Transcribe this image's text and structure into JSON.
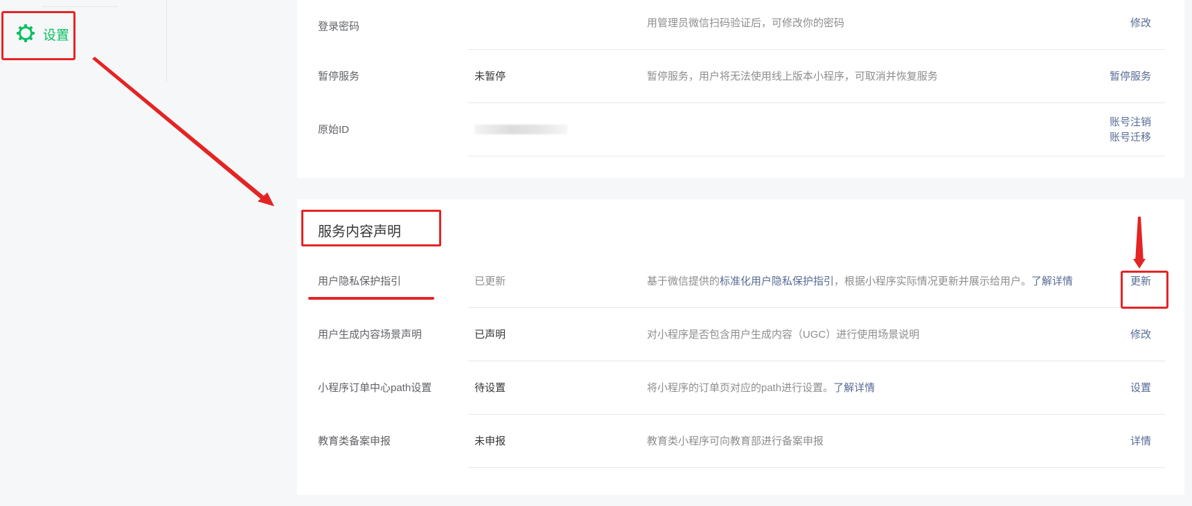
{
  "sidebar": {
    "settings_label": "设置",
    "settings_icon": "gear-icon",
    "accent": "#07c160"
  },
  "account_rows": [
    {
      "name": "登录密码",
      "status": "",
      "desc": "用管理员微信扫码验证后，可修改你的密码",
      "action": "修改"
    },
    {
      "name": "暂停服务",
      "status": "未暂停",
      "desc": "暂停服务，用户将无法使用线上版本小程序，可取消并恢复服务",
      "action": "暂停服务"
    },
    {
      "name": "原始ID",
      "status": "",
      "desc": "",
      "actions": [
        "账号注销",
        "账号迁移"
      ]
    }
  ],
  "service_section": {
    "title": "服务内容声明",
    "rows": [
      {
        "name": "用户隐私保护指引",
        "status": "已更新",
        "desc_prefix": "基于微信提供的",
        "desc_link": "标准化用户隐私保护指引",
        "desc_mid": "，根据小程序实际情况更新并展示给用户。",
        "desc_link2": "了解详情",
        "action": "更新"
      },
      {
        "name": "用户生成内容场景声明",
        "status": "已声明",
        "desc": "对小程序是否包含用户生成内容（UGC）进行使用场景说明",
        "action": "修改"
      },
      {
        "name": "小程序订单中心path设置",
        "status": "待设置",
        "desc_prefix": "将小程序的订单页对应的path进行设置。",
        "desc_link": "了解详情",
        "action": "设置"
      },
      {
        "name": "教育类备案申报",
        "status": "未申报",
        "desc": "教育类小程序可向教育部进行备案申报",
        "action": "详情"
      }
    ]
  },
  "colors": {
    "link": "#576b95",
    "annotation": "#e42424"
  }
}
